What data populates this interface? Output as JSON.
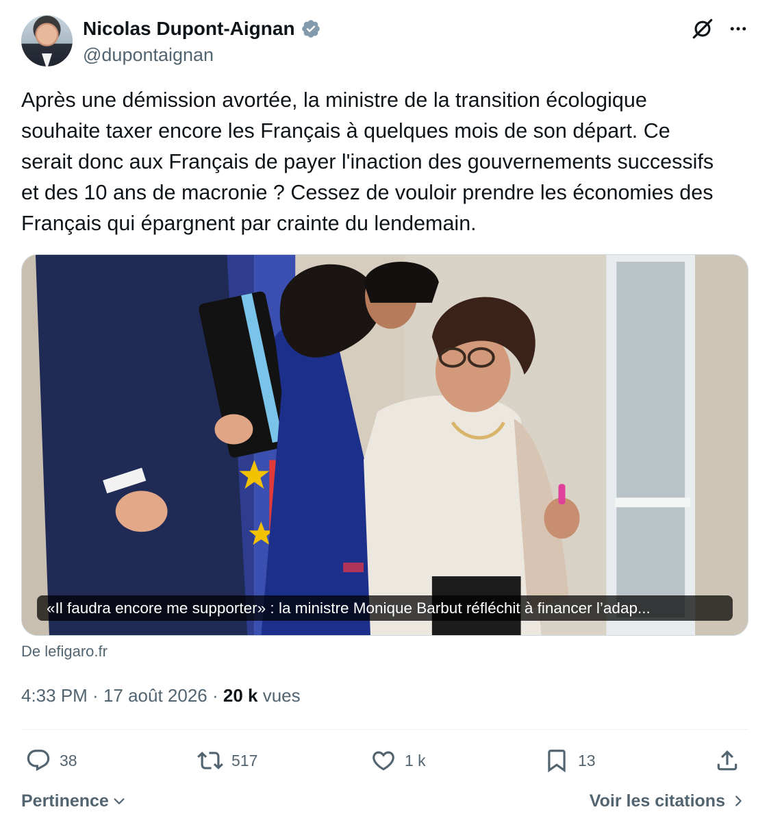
{
  "author": {
    "name": "Nicolas Dupont-Aignan",
    "handle": "@dupontaignan",
    "verified_icon": "verified-badge-icon"
  },
  "header_icons": [
    "grok-icon",
    "more-icon"
  ],
  "tweet": {
    "text": "Après une démission avortée, la ministre de la transition écologique souhaite taxer encore les Français à quelques mois de son départ. Ce serait donc aux Français de payer l'inaction des gouvernements successifs et des 10 ans de macronie ? Cessez de vouloir prendre les économies des Français qui épargnent par crainte du lendemain."
  },
  "link_card": {
    "caption": "«Il faudra encore me supporter» : la ministre Monique Barbut réfléchit à financer l’adap...",
    "source": "De lefigaro.fr"
  },
  "meta": {
    "time": "4:33 PM",
    "separator": " · ",
    "date": "17 août 2026",
    "views_count": "20 k",
    "views_label": "vues"
  },
  "actions": {
    "replies": "38",
    "reposts": "517",
    "likes": "1 k",
    "bookmarks": "13"
  },
  "footer": {
    "sort_label": "Pertinence",
    "quotes_label": "Voir les citations"
  },
  "colors": {
    "text": "#0f1419",
    "secondary": "#536471",
    "verified": "#829aab",
    "divider": "#eff3f4"
  }
}
